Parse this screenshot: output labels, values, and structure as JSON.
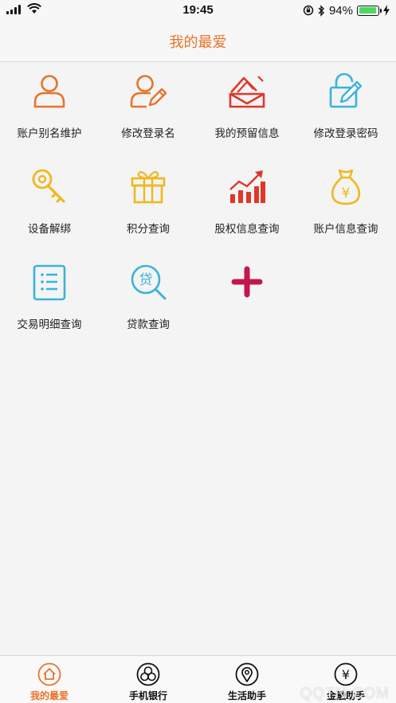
{
  "status": {
    "time": "19:45",
    "battery": "94%"
  },
  "header": {
    "title": "我的最爱"
  },
  "tiles": [
    {
      "label": "账户别名维护",
      "icon": "user-icon"
    },
    {
      "label": "修改登录名",
      "icon": "user-edit-icon"
    },
    {
      "label": "我的预留信息",
      "icon": "envelope-icon"
    },
    {
      "label": "修改登录密码",
      "icon": "lock-edit-icon"
    },
    {
      "label": "设备解绑",
      "icon": "key-icon"
    },
    {
      "label": "积分查询",
      "icon": "gift-icon"
    },
    {
      "label": "股权信息查询",
      "icon": "bar-chart-icon"
    },
    {
      "label": "账户信息查询",
      "icon": "money-bag-icon"
    },
    {
      "label": "交易明细查询",
      "icon": "list-icon"
    },
    {
      "label": "贷款查询",
      "icon": "loan-search-icon",
      "icon_text": "贷"
    }
  ],
  "tabs": [
    {
      "label": "我的最爱",
      "icon": "home-icon",
      "active": true
    },
    {
      "label": "手机银行",
      "icon": "bank-icon",
      "active": false
    },
    {
      "label": "生活助手",
      "icon": "location-icon",
      "active": false
    },
    {
      "label": "金融助手",
      "icon": "yuan-icon",
      "active": false,
      "icon_text": "¥"
    }
  ],
  "colors": {
    "accent": "#e8732b",
    "yellow": "#efb81f",
    "red": "#e0362b",
    "blue": "#3ab3d9",
    "add": "#c4174d"
  },
  "watermark": "QQTN.COM"
}
